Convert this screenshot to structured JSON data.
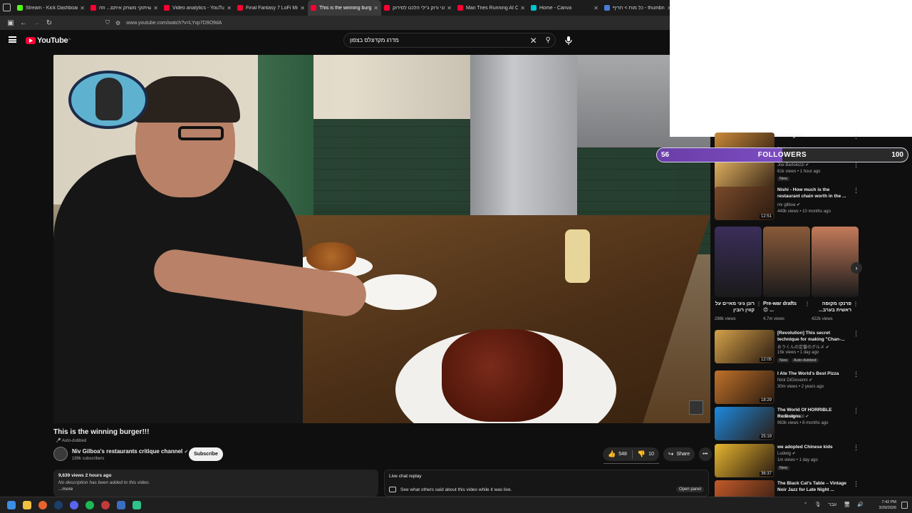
{
  "browser": {
    "tabs": [
      {
        "title": "Stream - Kick Dashboard",
        "color": "#53fc18",
        "active": false
      },
      {
        "title": "שיתוקי משחק איתם... וזה",
        "color": "#ff0033",
        "active": false
      },
      {
        "title": "Video analytics - YouTube Studio",
        "color": "#ff0033",
        "active": false
      },
      {
        "title": "Final Fantasy 7 LoFi Mix - [",
        "color": "#ff0033",
        "active": false
      },
      {
        "title": "This is the winning burger",
        "color": "#ff0033",
        "active": true
      },
      {
        "title": "אני ורוק ג'ילי הלכנו לסירוק",
        "color": "#ff0033",
        "active": false
      },
      {
        "title": "Man Tries Running At Cop W",
        "color": "#ff0033",
        "active": false
      },
      {
        "title": "Home - Canva",
        "color": "#00c4cc",
        "active": false
      },
      {
        "title": "כל מות > חריף - thumbnail",
        "color": "#4a7bd6",
        "active": false
      }
    ],
    "url": "www.youtube.com/watch?v=LYvp7D9O9dA"
  },
  "header": {
    "logo_text": "YouTube",
    "logo_suffix": "IL",
    "search_query": "מדרג מקדונלס בצפון"
  },
  "video": {
    "title": "This is the winning burger!!!",
    "auto_dubbed": "Auto-dubbed",
    "channel_name": "Niv Gilboa's restaurants critique channel",
    "subscribers": "189k subscribers",
    "subscribe_label": "Subscribe",
    "likes": "548",
    "dislikes": "10",
    "share_label": "Share",
    "views_meta": "9,639 views  2 hours ago",
    "description": "No description has been added to this video.",
    "more_label": "...more",
    "live_chat_label": "Live chat replay",
    "live_chat_desc": "See what others said about this video while it was live.",
    "open_panel_label": "Open panel"
  },
  "followers_bar": {
    "current": "56",
    "label": "FOLLOWERS",
    "goal": "100",
    "fill_fraction": 0.5
  },
  "recommendations_top": [
    {
      "title": "...er Saga Is",
      "channel": "",
      "meta": "714k views • 1 year ago",
      "duration": "12:05",
      "badge": ""
    },
    {
      "title": "",
      "channel": "Joe Bartolozzi",
      "meta": "61k views • 1 hour ago",
      "duration": "28:18",
      "badge": "New"
    },
    {
      "title": "Nishi - How much is the restaurant chain worth in the ...",
      "channel": "niv gilboa",
      "meta": "449k views • 10 months ago",
      "duration": "12:51",
      "badge": ""
    }
  ],
  "shorts": [
    {
      "title": "רונן גיגי מאיים על קווין רובין",
      "views": "288k views"
    },
    {
      "title": "Pre-war drafts 😍 ...",
      "views": "4.7m views"
    },
    {
      "title": "פרנקו מקופה ראשית בערב...",
      "views": "422k views"
    }
  ],
  "recommendations": [
    {
      "title": "[Revolution] This secret technique for making \"Chan-...",
      "channel": "おうくんの定番のグルメ",
      "meta": "15k views • 1 day ago",
      "duration": "12:05",
      "badge": "New",
      "badge2": "Auto-dubbed"
    },
    {
      "title": "I Ate The World's Best Pizza",
      "channel": "Nick DiGiovanni",
      "meta": "30m views • 2 years ago",
      "duration": "18:29",
      "badge": "",
      "badge2": ""
    },
    {
      "title": "The World Of HORRIBLE Redesigns",
      "channel": "Joe Bartolozzi",
      "meta": "963k views • 8 months ago",
      "duration": "25:19",
      "badge": "",
      "badge2": ""
    },
    {
      "title": "we adopted Chinese kids",
      "channel": "Ludwig",
      "meta": "1m views • 1 day ago",
      "duration": "36:37",
      "badge": "New",
      "badge2": ""
    },
    {
      "title": "The Black Cat's Table – Vintage Noir Jazz for Late Night ...",
      "channel": "",
      "meta": "",
      "duration": "",
      "badge": "",
      "badge2": ""
    }
  ],
  "taskbar": {
    "time": "7:42 PM",
    "date": "3/29/2026",
    "lang": "עבר"
  }
}
